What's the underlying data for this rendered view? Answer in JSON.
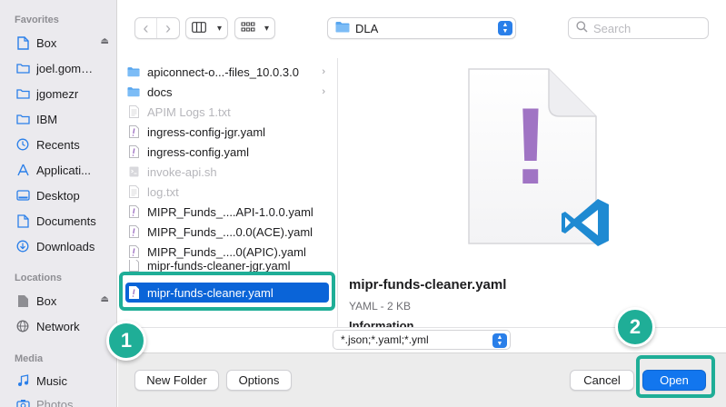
{
  "sidebar": {
    "favorites_heading": "Favorites",
    "favorites": [
      {
        "label": "Box",
        "icon": "document-icon",
        "eject": true
      },
      {
        "label": "joel.gomez...",
        "icon": "folder-icon",
        "eject": false
      },
      {
        "label": "jgomezr",
        "icon": "folder-icon",
        "eject": false
      },
      {
        "label": "IBM",
        "icon": "folder-icon",
        "eject": false
      },
      {
        "label": "Recents",
        "icon": "clock-icon",
        "eject": false
      },
      {
        "label": "Applicati...",
        "icon": "applications-icon",
        "eject": false
      },
      {
        "label": "Desktop",
        "icon": "desktop-icon",
        "eject": false
      },
      {
        "label": "Documents",
        "icon": "document-icon",
        "eject": false
      },
      {
        "label": "Downloads",
        "icon": "download-icon",
        "eject": false
      }
    ],
    "locations_heading": "Locations",
    "locations": [
      {
        "label": "Box",
        "icon": "drive-icon",
        "eject": true
      },
      {
        "label": "Network",
        "icon": "globe-icon",
        "eject": false
      }
    ],
    "media_heading": "Media",
    "media": [
      {
        "label": "Music",
        "icon": "music-icon",
        "eject": false
      },
      {
        "label": "Photos",
        "icon": "camera-icon",
        "eject": false
      }
    ],
    "eject_glyph": "⏏"
  },
  "toolbar": {
    "back_glyph": "‹",
    "forward_glyph": "›",
    "view_glyph": "▾",
    "group_glyph": "▾",
    "current_folder": "DLA",
    "search_placeholder": "Search"
  },
  "files": [
    {
      "name": "apiconnect-o...-files_10.0.3.0",
      "kind": "folder",
      "dim": false,
      "chevron": true
    },
    {
      "name": "docs",
      "kind": "folder",
      "dim": false,
      "chevron": true
    },
    {
      "name": "APIM Logs 1.txt",
      "kind": "text",
      "dim": true,
      "chevron": false
    },
    {
      "name": "ingress-config-jgr.yaml",
      "kind": "yaml",
      "dim": false,
      "chevron": false
    },
    {
      "name": "ingress-config.yaml",
      "kind": "yaml",
      "dim": false,
      "chevron": false
    },
    {
      "name": "invoke-api.sh",
      "kind": "script",
      "dim": true,
      "chevron": false
    },
    {
      "name": "log.txt",
      "kind": "text",
      "dim": true,
      "chevron": false
    },
    {
      "name": "MIPR_Funds_....API-1.0.0.yaml",
      "kind": "yaml",
      "dim": false,
      "chevron": false
    },
    {
      "name": "MIPR_Funds_....0.0(ACE).yaml",
      "kind": "yaml",
      "dim": false,
      "chevron": false
    },
    {
      "name": "MIPR_Funds_....0(APIC).yaml",
      "kind": "yaml",
      "dim": false,
      "chevron": false
    },
    {
      "name": "mipr-funds-cleaner-jgr.yaml",
      "kind": "yaml",
      "dim": false,
      "chevron": false
    },
    {
      "name": "mipr-funds-cleaner.yaml",
      "kind": "yaml",
      "dim": false,
      "chevron": false,
      "selected": true
    }
  ],
  "preview": {
    "file_name": "mipr-funds-cleaner.yaml",
    "meta": "YAML - 2 KB",
    "info_heading": "Information",
    "doc_glyph": "!"
  },
  "format": {
    "selected": "*.json;*.yaml;*.yml"
  },
  "footer": {
    "new_folder_label": "New Folder",
    "options_label": "Options",
    "cancel_label": "Cancel",
    "open_label": "Open"
  },
  "annotations": [
    {
      "number": "1"
    },
    {
      "number": "2"
    }
  ],
  "colors": {
    "accent": "#1276ee",
    "selection": "#0a64d8",
    "annotation": "#1fae97",
    "vscode_blue": "#1f8ad2",
    "yaml_purple": "#a074c4"
  }
}
